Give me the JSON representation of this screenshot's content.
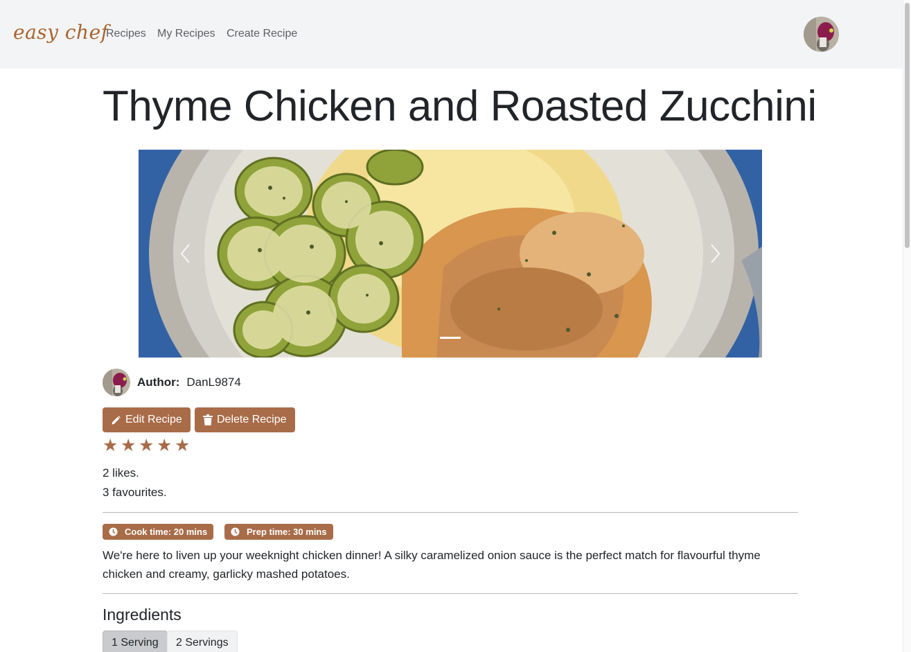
{
  "brand": "easy chef",
  "nav": {
    "links": [
      "Recipes",
      "My Recipes",
      "Create Recipe"
    ]
  },
  "recipe": {
    "title": "Thyme Chicken and Roasted Zucchini",
    "author_label": "Author:",
    "author_name": "DanL9874",
    "edit_label": "Edit Recipe",
    "delete_label": "Delete Recipe",
    "rating": 5,
    "rating_max": 5,
    "likes": "2 likes.",
    "favourites": "3 favourites.",
    "cook_time": "Cook time: 20 mins",
    "prep_time": "Prep time: 30 mins",
    "description": "We're here to liven up your weeknight chicken dinner! A silky caramelized onion sauce is the perfect match for flavourful thyme chicken and creamy, garlicky mashed potatoes."
  },
  "carousel": {
    "slides": 1,
    "active_slide": 1
  },
  "ingredients": {
    "heading": "Ingredients",
    "tabs": [
      {
        "label": "1 Serving",
        "active": true
      },
      {
        "label": "2 Servings",
        "active": false
      }
    ]
  },
  "colors": {
    "brand": "#a9642f",
    "accent": "#a86c48",
    "navbar_bg": "#f3f4f6"
  },
  "icons": {
    "edit": "pencil-icon",
    "delete": "trash-icon",
    "time": "clock-icon",
    "star": "star-icon",
    "prev": "chevron-left-icon",
    "next": "chevron-right-icon"
  }
}
